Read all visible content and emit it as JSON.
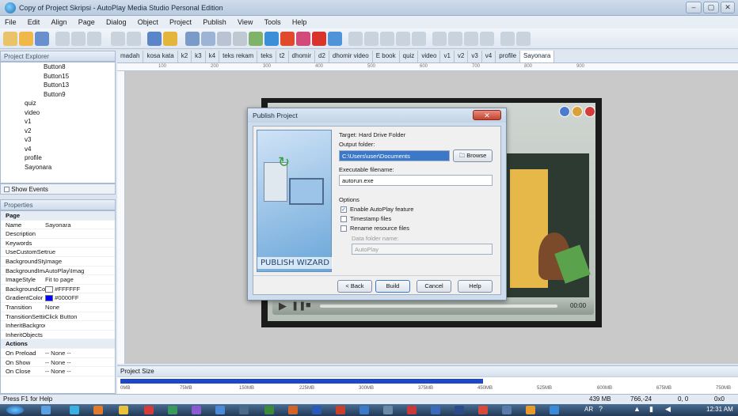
{
  "window": {
    "title": "Copy of Project Skripsi - AutoPlay Media Studio Personal Edition",
    "min": "–",
    "max": "▢",
    "close": "✕"
  },
  "menu": [
    "File",
    "Edit",
    "Align",
    "Page",
    "Dialog",
    "Object",
    "Project",
    "Publish",
    "View",
    "Tools",
    "Help"
  ],
  "project_explorer": {
    "title": "Project Explorer",
    "items": [
      "Button8",
      "Button15",
      "Button13",
      "Button9",
      "quiz",
      "video",
      "v1",
      "v2",
      "v3",
      "v4",
      "profile",
      "Sayonara"
    ],
    "show_events": "Show Events"
  },
  "properties": {
    "title": "Properties",
    "section_page": "Page",
    "rows": [
      {
        "k": "Name",
        "v": "Sayonara"
      },
      {
        "k": "Description",
        "v": ""
      },
      {
        "k": "Keywords",
        "v": ""
      },
      {
        "k": "UseCustomSett",
        "v": "true"
      },
      {
        "k": "BackgroundStyl",
        "v": "Image"
      },
      {
        "k": "BackgroundIma",
        "v": "AutoPlay\\Imag"
      },
      {
        "k": "ImageStyle",
        "v": "Fit to page"
      },
      {
        "k": "BackgroundCol",
        "v": "#FFFFFF"
      },
      {
        "k": "GradientColor",
        "v": "#0000FF"
      },
      {
        "k": "Transition",
        "v": "None"
      },
      {
        "k": "TransitionSettin",
        "v": "Click Button"
      },
      {
        "k": "InheritBackgrou",
        "v": ""
      },
      {
        "k": "InheritObjects",
        "v": ""
      }
    ],
    "section_actions": "Actions",
    "actions": [
      {
        "k": "On Preload",
        "v": "-- None --"
      },
      {
        "k": "On Show",
        "v": "-- None --"
      },
      {
        "k": "On Close",
        "v": "-- None --"
      }
    ]
  },
  "tabs": [
    "madah",
    "kosa kata",
    "k2",
    "k3",
    "k4",
    "teks rekam",
    "teks",
    "t2",
    "dhomir",
    "d2",
    "dhomir video",
    "E book",
    "quiz",
    "video",
    "v1",
    "v2",
    "v3",
    "v4",
    "profile",
    "Sayonara"
  ],
  "active_tab": "Sayonara",
  "ruler_ticks": [
    "100",
    "200",
    "300",
    "400",
    "500",
    "600",
    "700",
    "800",
    "900"
  ],
  "media_player": {
    "time": "00:00"
  },
  "dialog": {
    "title": "Publish Project",
    "target": "Target: Hard Drive Folder",
    "output_label": "Output folder:",
    "output_value": "C:\\Users\\user\\Documents",
    "browse": "Browse",
    "exe_label": "Executable filename:",
    "exe_value": "autorun.exe",
    "options_label": "Options",
    "opt_autoplay": "Enable AutoPlay feature",
    "opt_timestamp": "Timestamp files",
    "opt_rename": "Rename resource files",
    "data_folder_label": "Data folder name:",
    "data_folder_value": "AutoPlay",
    "wizard_label": "PUBLISH WIZARD",
    "back": "< Back",
    "build": "Build",
    "cancel": "Cancel",
    "help": "Help",
    "close": "✕"
  },
  "project_size": {
    "title": "Project Size",
    "ticks": [
      "0MB",
      "75MB",
      "150MB",
      "225MB",
      "300MB",
      "375MB",
      "450MB",
      "525MB",
      "600MB",
      "675MB",
      "750MB"
    ],
    "fill_fraction": 0.59
  },
  "status": {
    "help": "Press F1 for Help",
    "size": "439 MB",
    "coords": "766,-24",
    "pos": "0, 0",
    "dim": "0x0"
  },
  "taskbar": {
    "lang": "AR",
    "time": "12:31 AM"
  },
  "colors": {
    "bg_white": "#FFFFFF",
    "gradient_blue": "#0000FF"
  }
}
